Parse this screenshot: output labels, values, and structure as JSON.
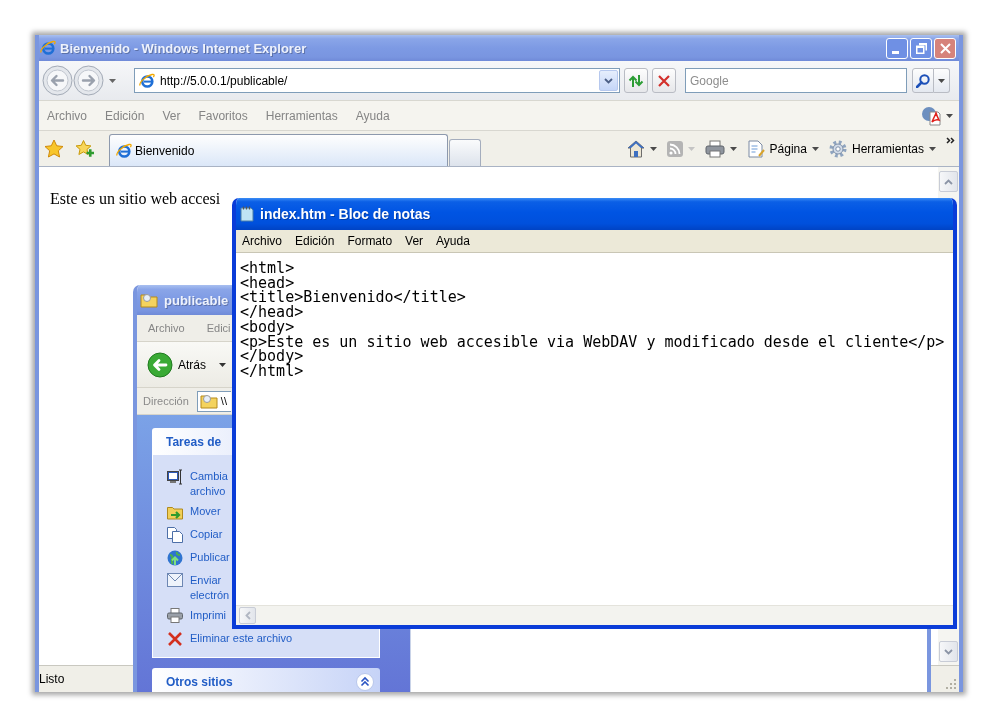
{
  "browser": {
    "active": false,
    "title": "Bienvenido - Windows Internet Explorer",
    "address": "http://5.0.0.1/publicable/",
    "search": {
      "placeholder": "Google"
    },
    "menu": [
      "Archivo",
      "Edición",
      "Ver",
      "Favoritos",
      "Herramientas",
      "Ayuda"
    ],
    "tabs": [
      {
        "label": "Bienvenido",
        "selected": true
      }
    ],
    "commands": [
      {
        "disabled": false
      },
      {
        "disabled": true
      },
      {
        "disabled": false
      },
      {
        "label": "Página",
        "disabled": false
      },
      {
        "label": "Herramientas",
        "disabled": false
      }
    ],
    "page_text": "Este es un sitio web accesi",
    "status": "Listo"
  },
  "explorer": {
    "active": false,
    "title": "publicable",
    "menu": [
      "Archivo",
      "Edici"
    ],
    "back_label": "Atrás",
    "address_label": "Dirección",
    "address": "\\\\",
    "task_panels": [
      {
        "title": "Tareas de",
        "items": [
          {
            "lines": [
              "Cambia",
              "archivo"
            ]
          },
          {
            "lines": [
              "Mover"
            ]
          },
          {
            "lines": [
              "Copiar"
            ]
          },
          {
            "lines": [
              "Publicar"
            ]
          },
          {
            "lines": [
              "Enviar",
              "electrón"
            ]
          },
          {
            "lines": [
              "Imprimi"
            ]
          },
          {
            "lines": [
              "Eliminar este archivo"
            ]
          }
        ]
      },
      {
        "title": "Otros sitios",
        "expanded": true
      }
    ]
  },
  "notepad": {
    "active": true,
    "title": "index.htm - Bloc de notas",
    "menu": [
      "Archivo",
      "Edición",
      "Formato",
      "Ver",
      "Ayuda"
    ],
    "lines": [
      "<html>",
      "<head>",
      "<title>Bienvenido</title>",
      "</head>",
      "<body>",
      "<p>Este es un sitio web accesible via WebDAV y modificado desde el cliente</p>",
      "</body>",
      "</html>"
    ]
  }
}
